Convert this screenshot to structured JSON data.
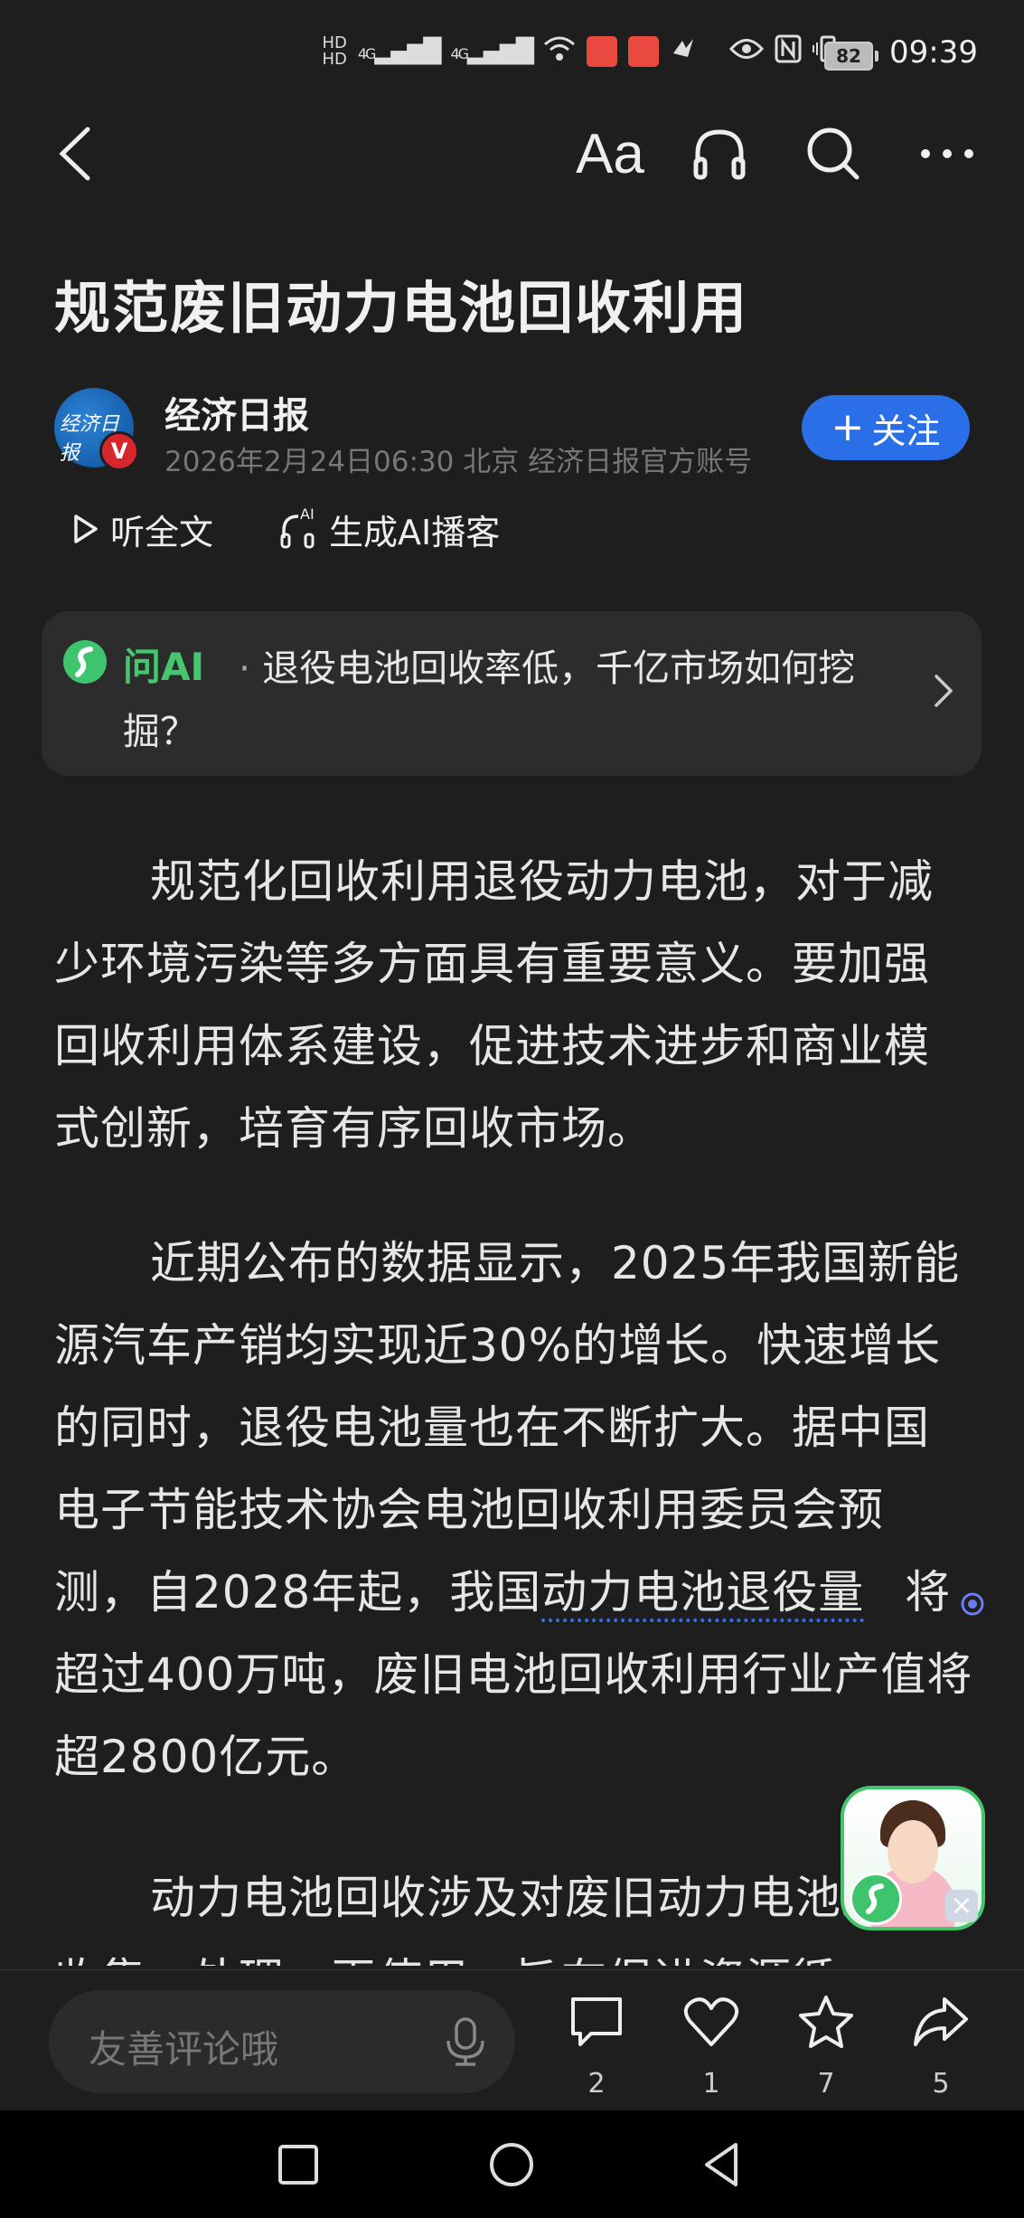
{
  "status": {
    "hd1": "HD",
    "hd2": "HD",
    "net1": "4G",
    "net2": "4G",
    "battery": "82",
    "time": "09:39"
  },
  "nav": {
    "font_label": "Aa"
  },
  "article": {
    "title": "规范废旧动力电池回收利用"
  },
  "author": {
    "name": "经济日报",
    "meta": "2026年2月24日06:30 北京 经济日报官方账号",
    "follow_label": "关注",
    "follow_plus": "+"
  },
  "listen": {
    "listen_label": "听全文",
    "podcast_label": "生成AI播客",
    "ai_tag": "AI"
  },
  "ai_card": {
    "label": "问AI",
    "separator": "·",
    "question": "退役电池回收率低，千亿市场如何挖掘？"
  },
  "body": {
    "p1": "规范化回收利用退役动力电池，对于减少环境污染等多方面具有重要意义。要加强回收利用体系建设，促进技术进步和商业模式创新，培育有序回收市场。",
    "p2_before": "近期公布的数据显示，2025年我国新能源汽车产销均实现近30%的增长。快速增长的同时，退役电池量也在不断扩大。据中国电子节能技术协会电池回收利用委员会预测，自2028年起，我国",
    "p2_link": "动力电池退役量",
    "p2_after": "将超过400万吨，废旧电池回收利用行业产值将超2800亿元。",
    "p3": "动力电池回收涉及对废旧动力电池进行收集、处理、再使用，旨在促进资源循"
  },
  "floating": {
    "close": "×"
  },
  "bottom_bar": {
    "comment_placeholder": "友善评论哦",
    "comments": "2",
    "likes": "1",
    "favorites": "7",
    "shares": "5"
  },
  "colors": {
    "background": "#1e1e1e",
    "accent_blue": "#2a6fe8",
    "ai_green": "#45c66f",
    "link_underline": "#3b6fe0"
  }
}
